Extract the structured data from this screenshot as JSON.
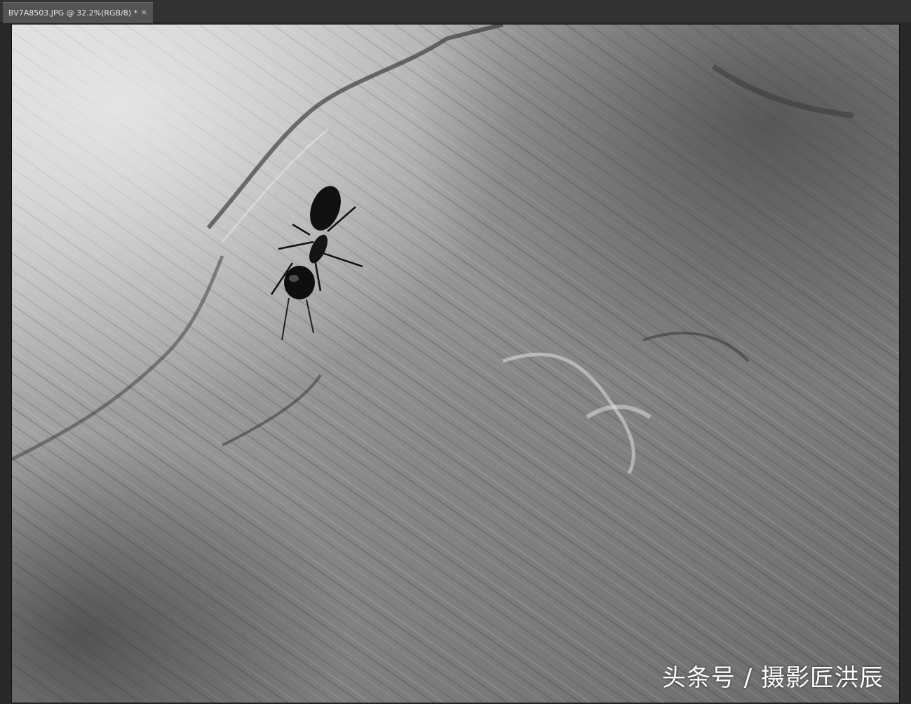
{
  "document_tab": {
    "title": "BV7A8503.JPG @ 32.2%(RGB/8) *",
    "close_glyph": "×"
  },
  "canvas": {
    "image_subject_icon": "ant-on-bark-photo",
    "watermark": "头条号 / 摄影匠洪辰"
  },
  "colors": {
    "workspace": "#282828",
    "tab_active": "#535353",
    "tab_text": "#e6e6e6"
  }
}
